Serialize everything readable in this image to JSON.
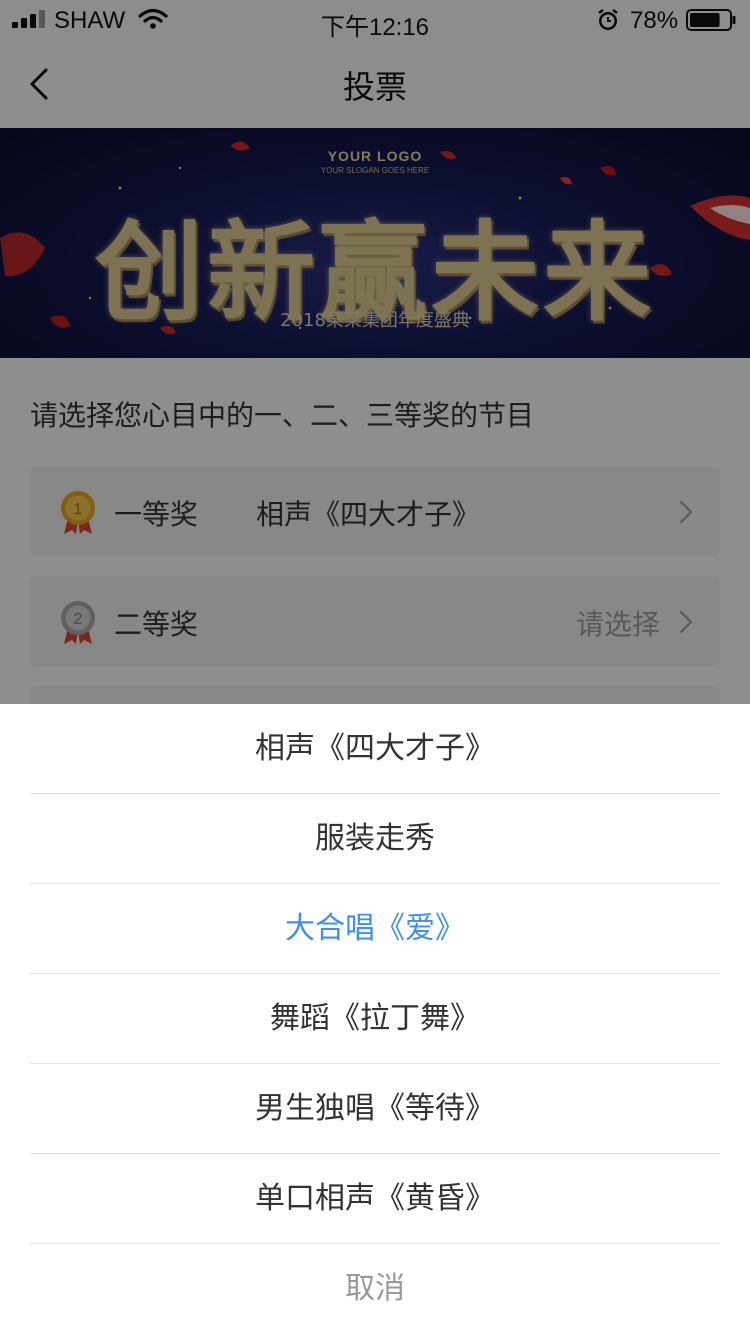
{
  "status_bar": {
    "carrier": "SHAW",
    "time": "下午12:16",
    "battery_percent": "78%",
    "battery_level": 0.78
  },
  "nav": {
    "title": "投票"
  },
  "banner": {
    "logo": "YOUR LOGO",
    "slogan": "YOUR SLOGAN GOES HERE",
    "headline": "创新赢未来",
    "subtitle": "2018某某集团年度盛典"
  },
  "vote": {
    "prompt": "请选择您心目中的一、二、三等奖的节目",
    "prizes": [
      {
        "label": "一等奖",
        "medal_number": "1",
        "value": "相声《四大才子》",
        "placeholder": ""
      },
      {
        "label": "二等奖",
        "medal_number": "2",
        "value": "",
        "placeholder": "请选择"
      }
    ]
  },
  "action_sheet": {
    "options": [
      {
        "label": "相声《四大才子》",
        "selected": false
      },
      {
        "label": "服装走秀",
        "selected": false
      },
      {
        "label": "大合唱《爱》",
        "selected": true
      },
      {
        "label": "舞蹈《拉丁舞》",
        "selected": false
      },
      {
        "label": "男生独唱《等待》",
        "selected": false
      },
      {
        "label": "单口相声《黄昏》",
        "selected": false
      }
    ],
    "cancel_label": "取消"
  },
  "colors": {
    "accent": "#3f8ef0",
    "gold_medal": "#e0a21c",
    "silver_medal": "#a6a6a6",
    "ribbon": "#d2452f"
  }
}
